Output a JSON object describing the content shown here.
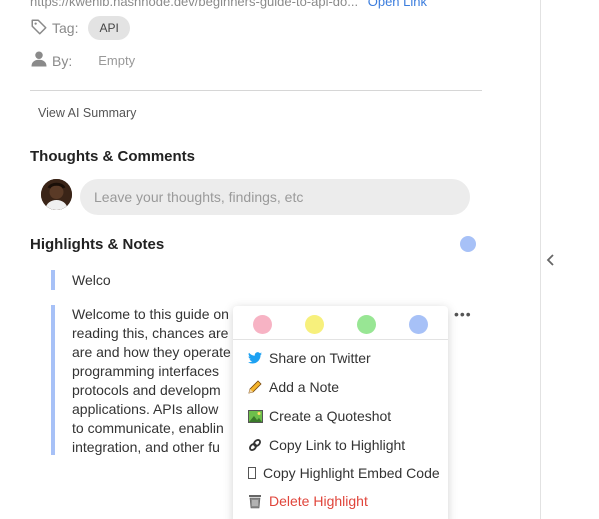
{
  "link": {
    "url": "https://kwehib.hashnode.dev/beginners-guide-to-api-do...",
    "open_label": "Open Link"
  },
  "meta": {
    "tag_label": "Tag:",
    "tag_value": "API",
    "by_label": "By:",
    "by_value": "Empty"
  },
  "ai_summary_label": "View AI Summary",
  "thoughts": {
    "title": "Thoughts & Comments",
    "placeholder": "Leave your thoughts, findings, etc"
  },
  "highlights": {
    "title": "Highlights & Notes",
    "accent_color": "#a7c1f7",
    "items": [
      {
        "lines": [
          "Welco"
        ]
      },
      {
        "lines": [
          "Welcome to this guide on",
          "reading this, chances are",
          "are and how they operate",
          "programming interfaces",
          "protocols and developm",
          "applications. APIs allow",
          "to communicate, enablin",
          "integration, and other fu"
        ]
      }
    ]
  },
  "popup": {
    "colors": [
      "#f7b3c4",
      "#f7f07c",
      "#98e694",
      "#a7c1f7"
    ],
    "menu": [
      {
        "label": "Share on Twitter",
        "icon": "twitter-icon"
      },
      {
        "label": "Add a Note",
        "icon": "pencil-icon"
      },
      {
        "label": "Create a Quoteshot",
        "icon": "image-icon"
      },
      {
        "label": "Copy Link to Highlight",
        "icon": "link-icon"
      },
      {
        "label": "Copy Highlight Embed Code",
        "icon": "code-icon"
      },
      {
        "label": "Delete Highlight",
        "icon": "trash-icon",
        "color": "#e0453b"
      }
    ]
  }
}
